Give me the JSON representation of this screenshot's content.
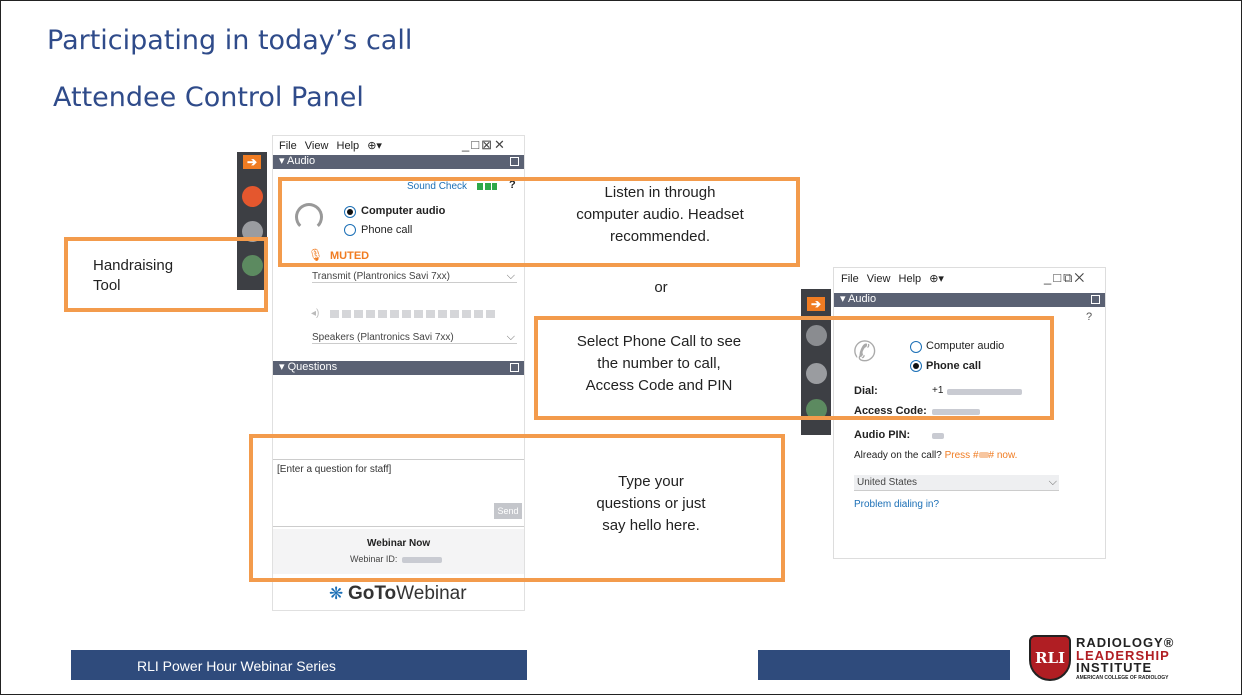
{
  "slide": {
    "title": "Participating in today’s call",
    "subtitle": "Attendee Control Panel"
  },
  "left_panel": {
    "menu": [
      "File",
      "View",
      "Help"
    ],
    "audio_section": "Audio",
    "sound_check": "Sound Check",
    "computer_audio": "Computer audio",
    "phone_call": "Phone call",
    "muted": "MUTED",
    "transmit_device": "Transmit (Plantronics Savi 7xx)",
    "speakers_device": "Speakers (Plantronics Savi 7xx)",
    "questions_section": "Questions",
    "question_placeholder": "[Enter a question for staff]",
    "send_label": "Send",
    "webinar_name": "Webinar Now",
    "webinar_id_label": "Webinar ID:",
    "brand_goto": "GoTo",
    "brand_webinar": "Webinar"
  },
  "right_panel": {
    "menu": [
      "File",
      "View",
      "Help"
    ],
    "audio_section": "Audio",
    "computer_audio": "Computer audio",
    "phone_call": "Phone call",
    "dial_label": "Dial:",
    "dial_prefix": "+1",
    "access_code_label": "Access Code:",
    "audio_pin_label": "Audio PIN:",
    "already_on_call": "Already on the call?",
    "press_text": "Press #",
    "press_suffix": "# now.",
    "country": "United States",
    "problem_dialing": "Problem dialing in?"
  },
  "callouts": {
    "handraising_line1": "Handraising",
    "handraising_line2": "Tool",
    "listen_line1": "Listen in through",
    "listen_line2": "computer audio. Headset",
    "listen_line3": "recommended.",
    "or": "or",
    "phone_line1": "Select Phone Call to see",
    "phone_line2": "the number to call,",
    "phone_line3": "Access Code and PIN",
    "type_line1": "Type your",
    "type_line2": "questions or just",
    "type_line3": "say hello here."
  },
  "footer": {
    "series": "RLI Power Hour Webinar Series",
    "logo_line1": "RADIOLOGY®",
    "logo_line2": "LEADERSHIP",
    "logo_line3": "INSTITUTE",
    "logo_line4": "AMERICAN COLLEGE OF RADIOLOGY"
  },
  "colors": {
    "title": "#2f4b8a",
    "callout_border": "#f39b4c",
    "footer_bar": "#2f4b7c",
    "section_header": "#5a6173",
    "accent_orange": "#f07c22"
  }
}
